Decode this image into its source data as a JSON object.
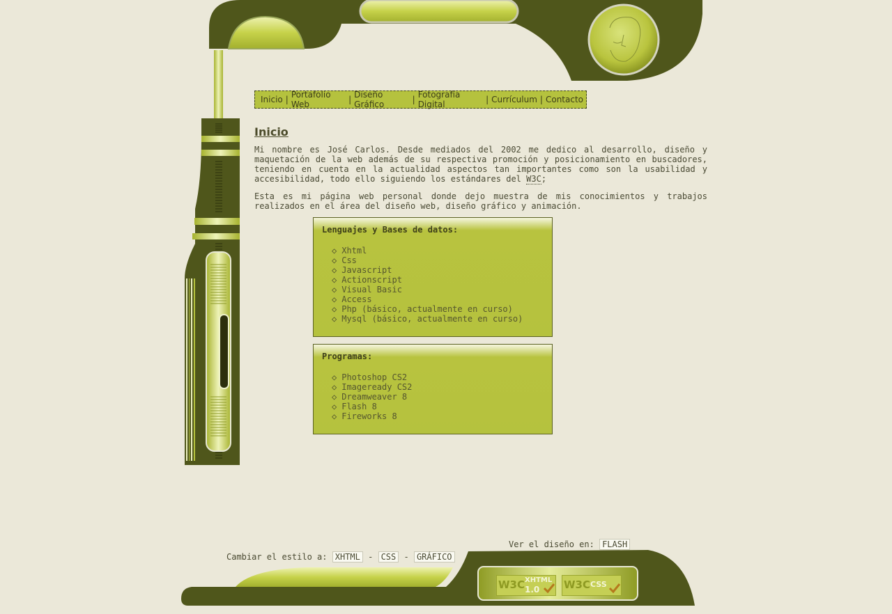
{
  "nav": {
    "items": [
      "Inicio",
      "Portafolio Web",
      "Diseño Gráfico",
      "Fotografía Digital",
      "Currículum",
      "Contacto"
    ],
    "separator": "|"
  },
  "content": {
    "title": "Inicio",
    "para1_before": "Mi nombre es José Carlos. Desde mediados del 2002 me dedico al desarrollo, diseño y maquetación de la web además de su respectiva promoción y posicionamiento en buscadores, teniendo en cuenta en la actualidad aspectos tan importantes como son la usabilidad y accesibilidad, todo ello siguiendo los estándares del ",
    "para1_abbr": "W3C",
    "para1_after": ";",
    "para2": "Esta es mi página web personal donde dejo muestra de mis conocimientos y trabajos realizados en el área del diseño web, diseño gráfico y animación."
  },
  "languages_box": {
    "title": "Lenguajes y Bases de datos:",
    "bullet": "◇",
    "items": [
      "Xhtml",
      "Css",
      "Javascript",
      "Actionscript",
      "Visual Basic",
      "Access",
      "Php (básico, actualmente en curso)",
      "Mysql (básico, actualmente en curso)"
    ]
  },
  "programs_box": {
    "title": "Programas:",
    "bullet": "◇",
    "items": [
      "Photoshop CS2",
      "Imageready CS2",
      "Dreamweaver 8",
      "Flash 8",
      "Fireworks 8"
    ]
  },
  "footer": {
    "view_design_label": "Ver el diseño en:",
    "flash_link": "FLASH",
    "change_style_label": "Cambiar el estilo a:",
    "style_links": [
      "XHTML",
      "CSS",
      "GRÁFICO"
    ],
    "link_separator": "-",
    "badges": [
      {
        "w3c": "W3C",
        "name": "XHTML",
        "version": "1.0"
      },
      {
        "w3c": "W3C",
        "name": "CSS"
      }
    ]
  },
  "colors": {
    "background": "#ebe8d9",
    "olive_dark": "#4f561b",
    "lime": "#b5c23e"
  }
}
